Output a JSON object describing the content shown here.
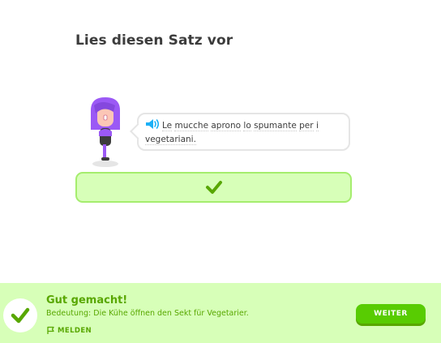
{
  "challenge": {
    "title": "Lies diesen Satz vor"
  },
  "speech_bubble": {
    "words_line1": [
      "Le",
      "mucche",
      "aprono",
      "lo",
      "spumante",
      "per",
      "i"
    ],
    "words_line2": [
      "vegetariani."
    ],
    "speaker_icon": "speaker-icon"
  },
  "answer": {
    "check_icon": "checkmark-icon",
    "state": "correct"
  },
  "feedback": {
    "title": "Gut gemacht!",
    "meaning": "Bedeutung: Die Kühe öffnen den Sekt für Vegetarier.",
    "report_label": "MELDEN",
    "continue_label": "WEITER"
  },
  "colors": {
    "success_bg": "#d7ffb8",
    "success_text": "#58a700",
    "button_green": "#58cc02",
    "speaker_blue": "#1cb0f6",
    "character_purple": "#9b59f5"
  }
}
